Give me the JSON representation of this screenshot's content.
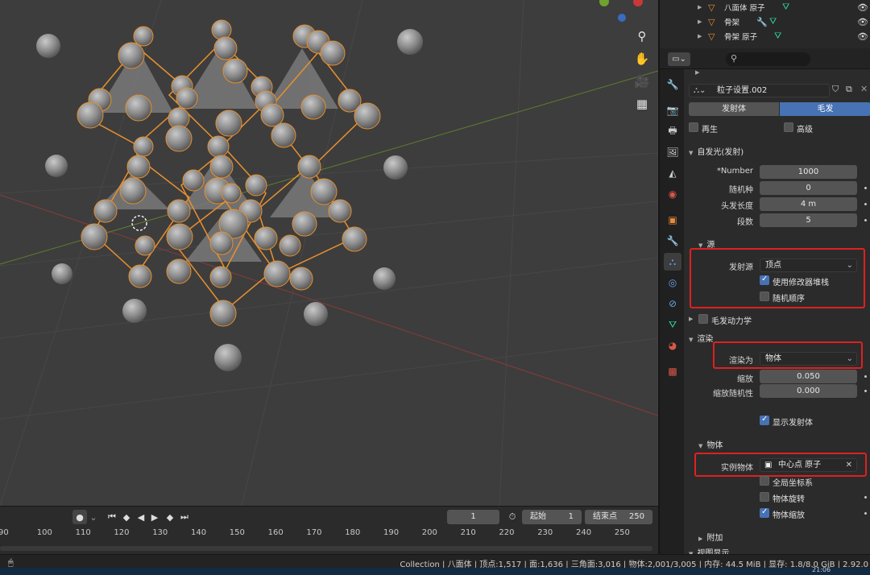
{
  "outliner": {
    "rows": [
      {
        "label": "八面体 原子"
      },
      {
        "label": "骨架"
      },
      {
        "label": "骨架 原子"
      }
    ]
  },
  "colors": {
    "accent": "#4772b3",
    "highlight": "#e02020",
    "wire": "#e8902f",
    "viewport_bg": "#3d3d3d"
  },
  "props": {
    "editor_icon": "properties-editor-icon",
    "search_icon": "search-icon",
    "datablock_name": "粒子设置.002",
    "type_tabs": [
      "发射体",
      "毛发"
    ],
    "advanced_row": {
      "regrow": "再生",
      "advanced": "高级"
    },
    "emission": {
      "header": "自发光(发射)",
      "number_label": "*Number",
      "number_value": "1000",
      "seed_label": "随机种",
      "seed_value": "0",
      "hair_length_label": "头发长度",
      "hair_length_value": "4 m",
      "segments_label": "段数",
      "segments_value": "5"
    },
    "source": {
      "header": "源",
      "emit_from_label": "发射源",
      "emit_from_value": "顶点",
      "use_modifier_stack": "使用修改器堆栈",
      "random_order": "随机顺序"
    },
    "hair_dynamics": {
      "header": "毛发动力学"
    },
    "render": {
      "header": "渲染",
      "render_as_label": "渲染为",
      "render_as_value": "物体",
      "scale_label": "缩放",
      "scale_value": "0.050",
      "scale_rand_label": "缩放随机性",
      "scale_rand_value": "0.000",
      "show_emitter": "显示发射体"
    },
    "object": {
      "header": "物体",
      "instance_label": "实例物体",
      "instance_value": "中心点 原子",
      "global_coords": "全局坐标系",
      "object_rotation": "物体旋转",
      "object_scale": "物体缩放"
    },
    "extra": {
      "header": "附加"
    },
    "viewport_display": {
      "header": "视图显示"
    }
  },
  "timeline": {
    "current_frame": "1",
    "start_label": "起始",
    "start_value": "1",
    "end_label": "结束点",
    "end_value": "250",
    "ticks": [
      "90",
      "100",
      "110",
      "120",
      "130",
      "140",
      "150",
      "160",
      "170",
      "180",
      "190",
      "200",
      "210",
      "220",
      "230",
      "240",
      "250"
    ]
  },
  "status": {
    "text": "Collection | 八面体 | 顶点:1,517 | 面:1,636 | 三角面:3,016 | 物体:2,001/3,005 | 内存: 44.5 MiB | 显存: 1.8/8.0 GiB | 2.92.0",
    "clock": "21:06"
  }
}
